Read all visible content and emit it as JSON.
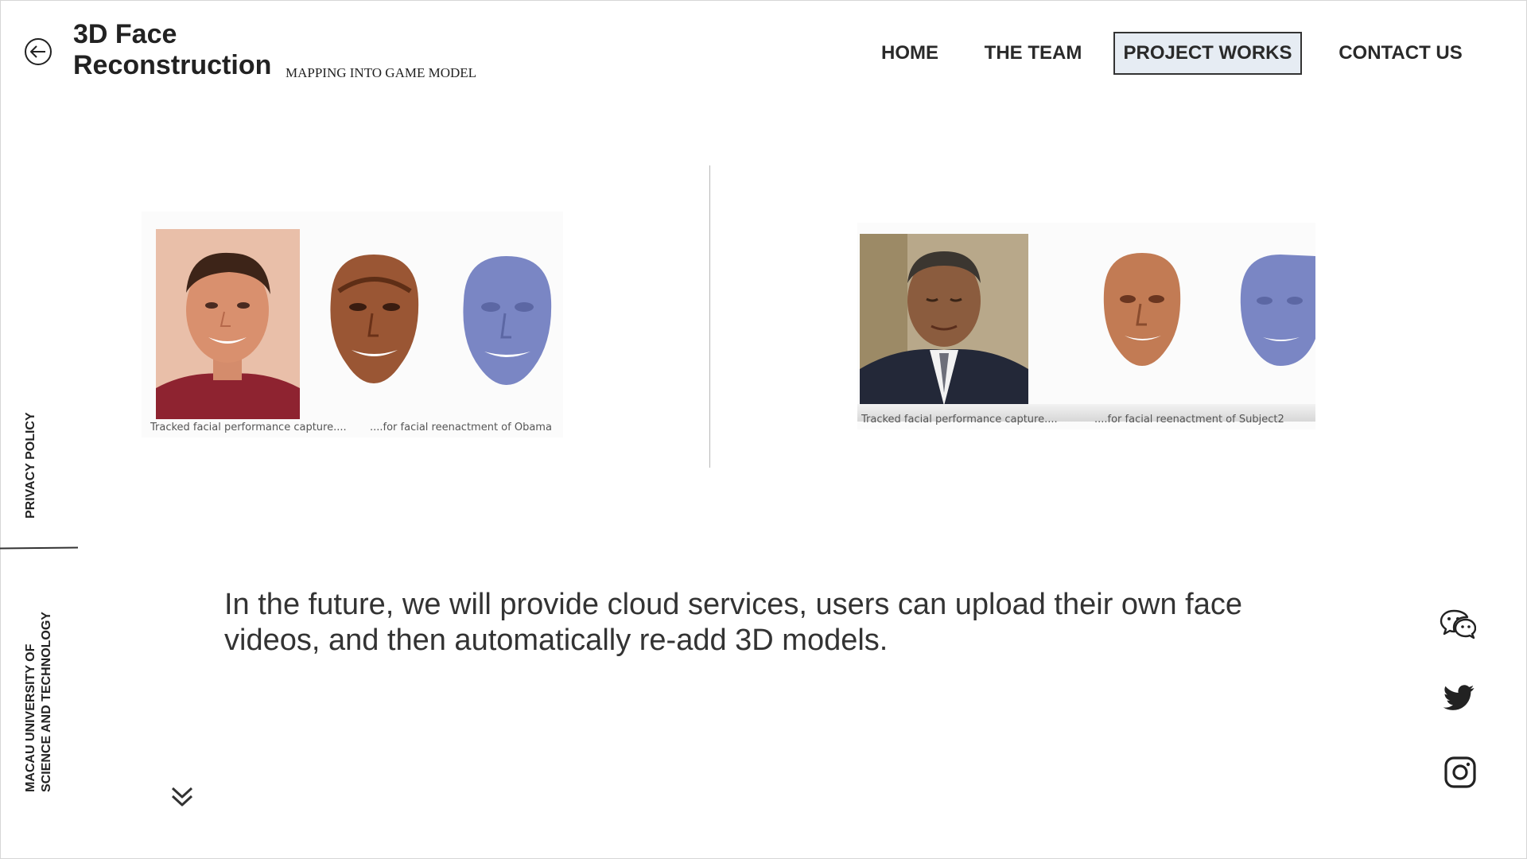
{
  "header": {
    "title": "3D Face Reconstruction",
    "title_line1": "3D Face",
    "title_line2": "Reconstruction",
    "subtitle": "MAPPING INTO GAME MODEL"
  },
  "nav": {
    "home": "HOME",
    "team": "THE TEAM",
    "works": "PROJECT WORKS",
    "contact": "CONTACT US",
    "active": "PROJECT WORKS"
  },
  "figures": {
    "left": {
      "caption_a": "Tracked facial performance capture....",
      "caption_b": "....for facial reenactment of Obama"
    },
    "right": {
      "caption_a": "Tracked facial performance capture....",
      "caption_b": "....for facial reenactment of Subject2"
    }
  },
  "main": {
    "text": "In the future, we will provide cloud services, users can upload their own face videos, and then automatically re-add 3D models."
  },
  "sidebar": {
    "privacy": "PRIVACY POLICY",
    "university_line1": "MACAU UNIVERSITY OF",
    "university_line2": "SCIENCE AND TECHNOLOGY"
  },
  "icons": {
    "back": "arrow-left-circle-icon",
    "scroll": "double-chevron-down-icon",
    "social": [
      "wechat-icon",
      "twitter-icon",
      "instagram-icon"
    ]
  },
  "colors": {
    "text": "#222222",
    "nav_active_bg": "#e6ecf3",
    "mesh_blue": "#7a86c4",
    "skin_tone": "#b9724a"
  }
}
